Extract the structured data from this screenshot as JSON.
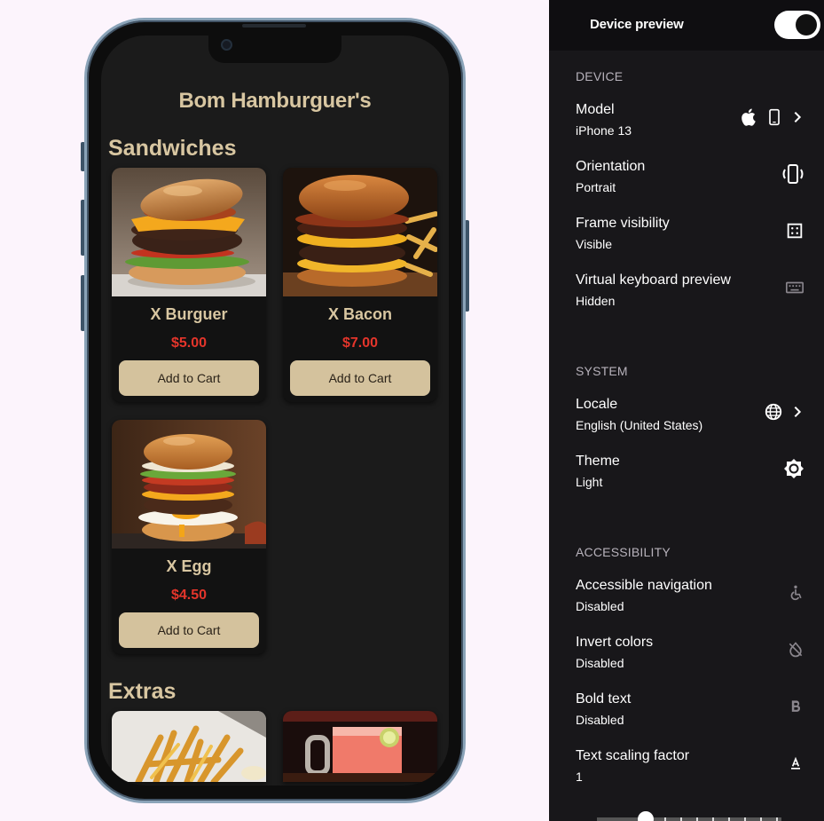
{
  "app": {
    "title": "Bom Hamburguer's",
    "sections": {
      "sandwiches": "Sandwiches",
      "extras": "Extras"
    },
    "products": [
      {
        "name": "X Burguer",
        "price": "$5.00",
        "button": "Add to Cart"
      },
      {
        "name": "X Bacon",
        "price": "$7.00",
        "button": "Add to Cart"
      },
      {
        "name": "X Egg",
        "price": "$4.50",
        "button": "Add to Cart"
      }
    ],
    "extras_images": [
      "french-fries-image",
      "pink-drink-image"
    ]
  },
  "panel": {
    "header": {
      "title": "Device preview",
      "toggle_on": true
    },
    "device": {
      "heading": "DEVICE",
      "model": {
        "label": "Model",
        "value": "iPhone 13"
      },
      "orientation": {
        "label": "Orientation",
        "value": "Portrait"
      },
      "frame": {
        "label": "Frame visibility",
        "value": "Visible"
      },
      "keyboard": {
        "label": "Virtual keyboard preview",
        "value": "Hidden"
      }
    },
    "system": {
      "heading": "SYSTEM",
      "locale": {
        "label": "Locale",
        "value": "English (United States)"
      },
      "theme": {
        "label": "Theme",
        "value": "Light"
      }
    },
    "accessibility": {
      "heading": "ACCESSIBILITY",
      "navigation": {
        "label": "Accessible navigation",
        "value": "Disabled"
      },
      "invert": {
        "label": "Invert colors",
        "value": "Disabled"
      },
      "bold": {
        "label": "Bold text",
        "value": "Disabled"
      },
      "scaling": {
        "label": "Text scaling factor",
        "value": "1"
      }
    }
  },
  "colors": {
    "accent_text": "#d8c6a1",
    "price_red": "#e4352b",
    "button_bg": "#d4c29d",
    "panel_bg": "#18171a"
  }
}
